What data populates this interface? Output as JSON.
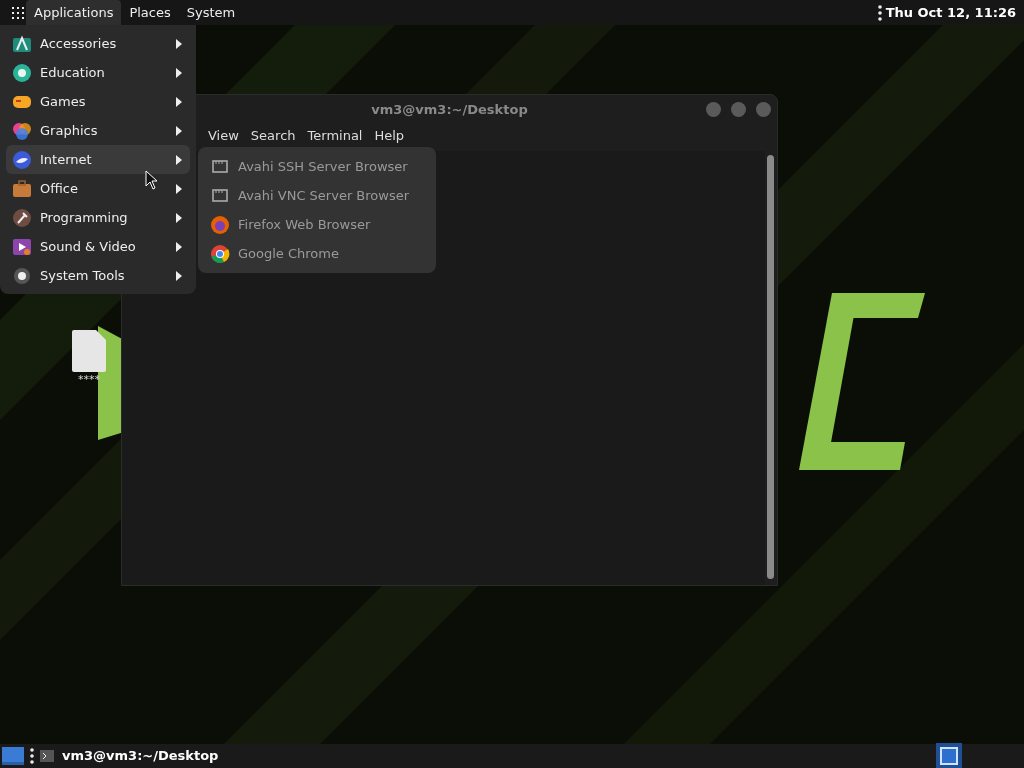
{
  "top_panel": {
    "menus": [
      {
        "label": "Applications",
        "selected": true
      },
      {
        "label": "Places",
        "selected": false
      },
      {
        "label": "System",
        "selected": false
      }
    ],
    "clock": "Thu Oct 12, 11:26"
  },
  "applications_menu": {
    "items": [
      {
        "label": "Accessories",
        "selected": false
      },
      {
        "label": "Education",
        "selected": false
      },
      {
        "label": "Games",
        "selected": false
      },
      {
        "label": "Graphics",
        "selected": false
      },
      {
        "label": "Internet",
        "selected": true
      },
      {
        "label": "Office",
        "selected": false
      },
      {
        "label": "Programming",
        "selected": false
      },
      {
        "label": "Sound & Video",
        "selected": false
      },
      {
        "label": "System Tools",
        "selected": false
      }
    ]
  },
  "internet_submenu": {
    "items": [
      {
        "label": "Avahi SSH Server Browser"
      },
      {
        "label": "Avahi VNC Server Browser"
      },
      {
        "label": "Firefox Web Browser"
      },
      {
        "label": "Google Chrome"
      }
    ]
  },
  "terminal": {
    "title": "vm3@vm3:~/Desktop",
    "menus": [
      "View",
      "Search",
      "Terminal",
      "Help"
    ]
  },
  "desktop": {
    "icons": [
      {
        "label": "****"
      }
    ]
  },
  "bottom_panel": {
    "tasks": [
      {
        "label": "vm3@vm3:~/Desktop"
      }
    ],
    "workspaces": [
      {
        "selected": true
      }
    ]
  }
}
